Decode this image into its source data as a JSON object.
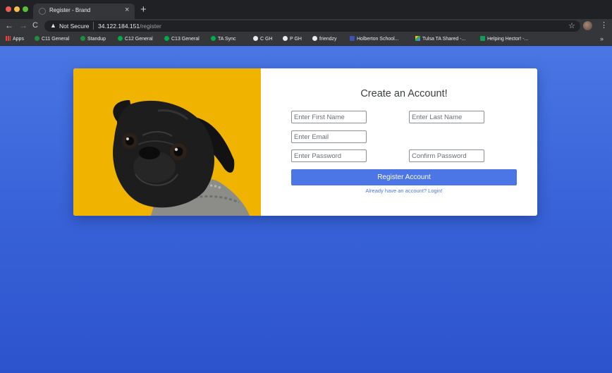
{
  "browser": {
    "tab_title": "Register - Brand",
    "close_glyph": "×",
    "new_tab_glyph": "+",
    "back_glyph": "←",
    "forward_glyph": "→",
    "reload_glyph": "C",
    "security_label": "Not Secure",
    "url_host": "34.122.184.151",
    "url_path": "/register",
    "star_glyph": "☆",
    "menu_glyph": "⋮",
    "bookmarks_more": "»"
  },
  "bookmarks": [
    {
      "label": "Apps",
      "icon": "apps-grid-icon"
    },
    {
      "label": "C11 General",
      "icon": "meet-icon"
    },
    {
      "label": "Standup",
      "icon": "meet-icon"
    },
    {
      "label": "C12 General",
      "icon": "chat-icon"
    },
    {
      "label": "C13 General",
      "icon": "chat-icon"
    },
    {
      "label": "TA Sync",
      "icon": "chat-icon"
    },
    {
      "label": "C GH",
      "icon": "github-icon"
    },
    {
      "label": "P GH",
      "icon": "github-icon"
    },
    {
      "label": "friendzy",
      "icon": "github-icon"
    },
    {
      "label": "Holberton School...",
      "icon": "holberton-icon"
    },
    {
      "label": "Tulsa TA Shared -...",
      "icon": "drive-icon"
    },
    {
      "label": "Helping Hector! -...",
      "icon": "sheets-icon"
    }
  ],
  "register": {
    "title": "Create an Account!",
    "first_name_placeholder": "Enter First Name",
    "last_name_placeholder": "Enter Last Name",
    "email_placeholder": "Enter Email",
    "password_placeholder": "Enter Password",
    "confirm_placeholder": "Confirm Password",
    "submit_label": "Register Account",
    "login_link": "Already have an account? Login!"
  },
  "colors": {
    "page_background": "#3b68d9",
    "accent": "#4c76e6",
    "photo_background": "#f0b400"
  }
}
